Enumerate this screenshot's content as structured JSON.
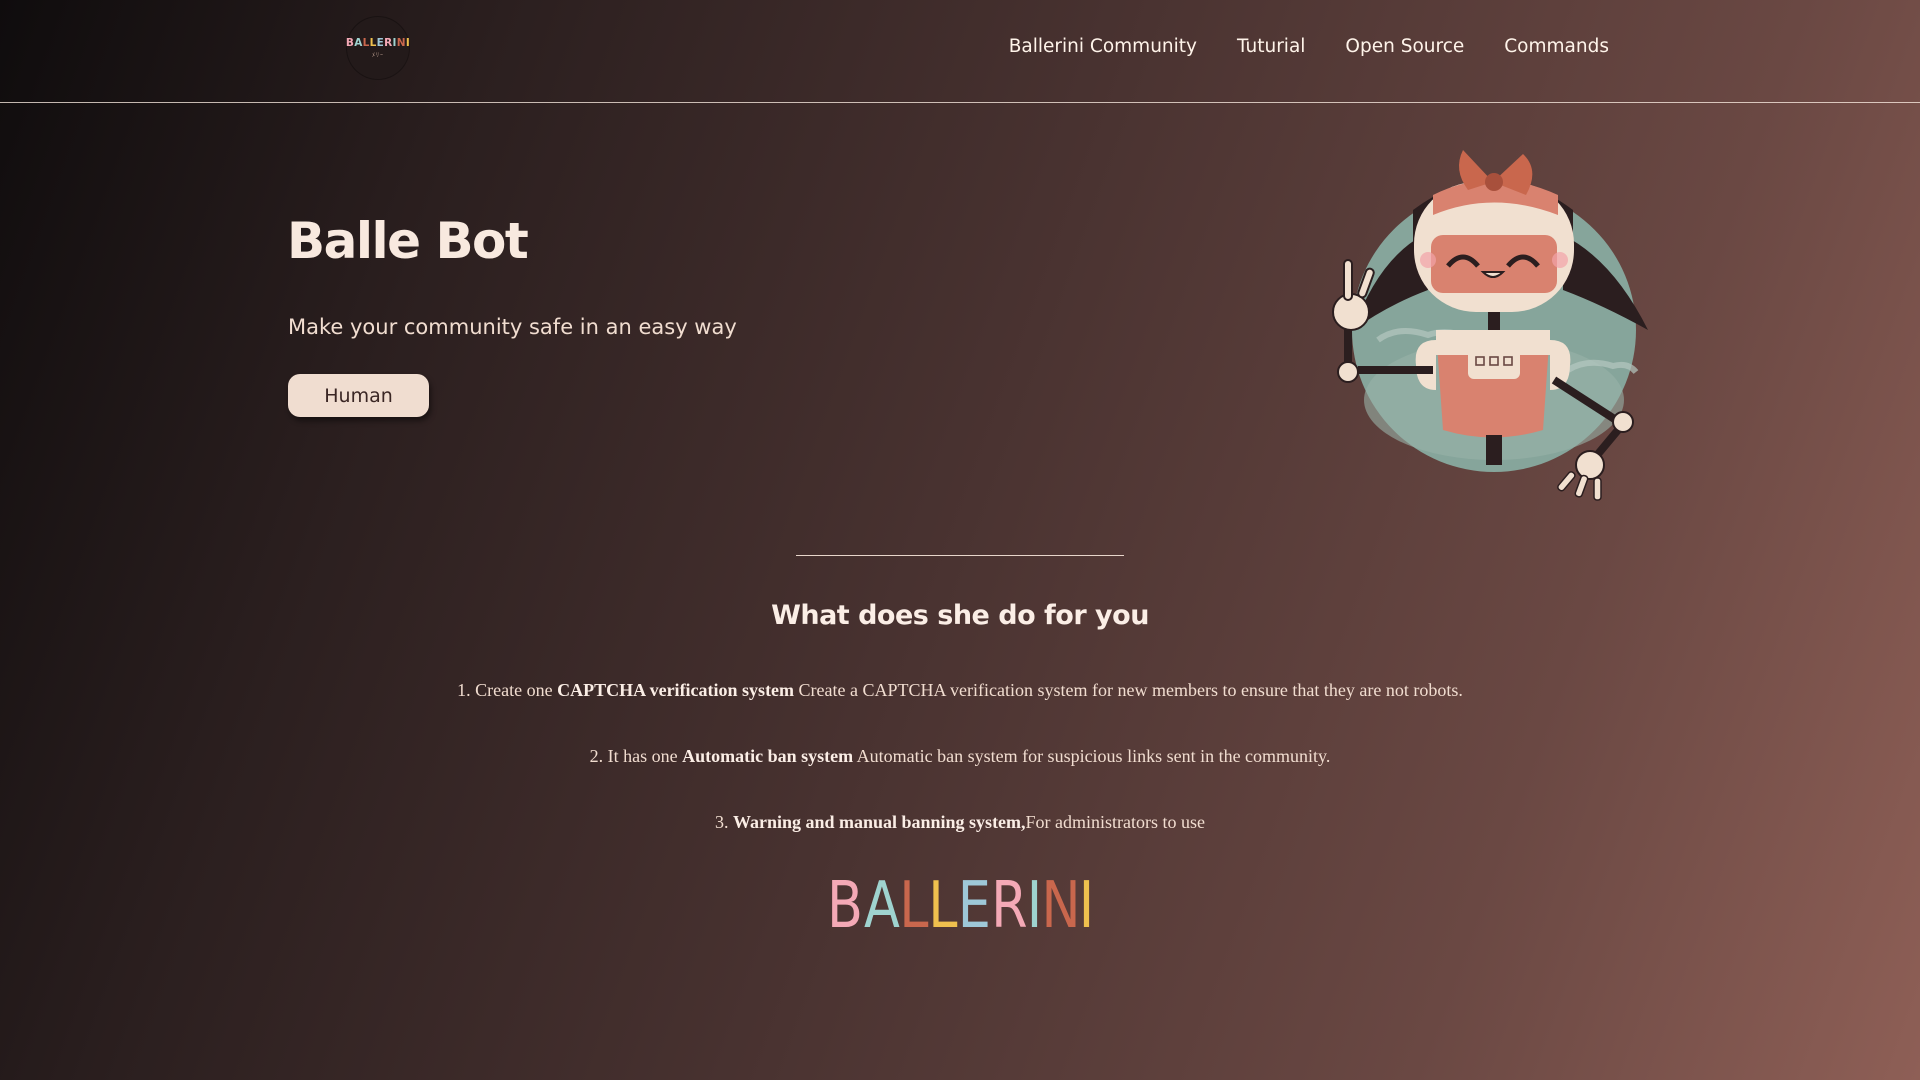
{
  "header": {
    "logo_text": "BALLERINI",
    "logo_sub": "ﾒﾘｰ",
    "nav": [
      "Ballerini Community",
      "Tuturial",
      "Open Source",
      "Commands"
    ]
  },
  "hero": {
    "title": "Balle Bot",
    "subtitle": "Make your community safe in an easy way",
    "button_label": "Human"
  },
  "section": {
    "title": "What does she do for you",
    "features": [
      {
        "prefix": "1. Create one ",
        "bold": "CAPTCHA verification system",
        "suffix": " Create a CAPTCHA verification system for new members to ensure that they are not robots."
      },
      {
        "prefix": "2. It has one ",
        "bold": "Automatic ban system",
        "suffix": " Automatic ban system for suspicious links sent in the community."
      },
      {
        "prefix": "3. ",
        "bold": "Warning and manual banning system,",
        "suffix": "For administrators to use"
      }
    ]
  },
  "footer": {
    "wordmark_letters": [
      "B",
      "A",
      "L",
      "L",
      "E",
      "R",
      "I",
      "N",
      "I"
    ],
    "wordmark_colors": [
      "#f4a9b6",
      "#9fd3cf",
      "#c9674d",
      "#efc04e",
      "#9ec8d8",
      "#f4a9b6",
      "#9fd3cf",
      "#c9674d",
      "#efc04e"
    ]
  },
  "colors": {
    "accent_button": "#f0ddd0",
    "robot_pink": "#d9826f",
    "robot_cream": "#f1e0d0",
    "robot_hair": "#2b1e1f",
    "robot_bg": "#8faaa0"
  },
  "icons": {
    "logo": "ballerini-logo",
    "mascot": "robot-mascot-illustration"
  }
}
